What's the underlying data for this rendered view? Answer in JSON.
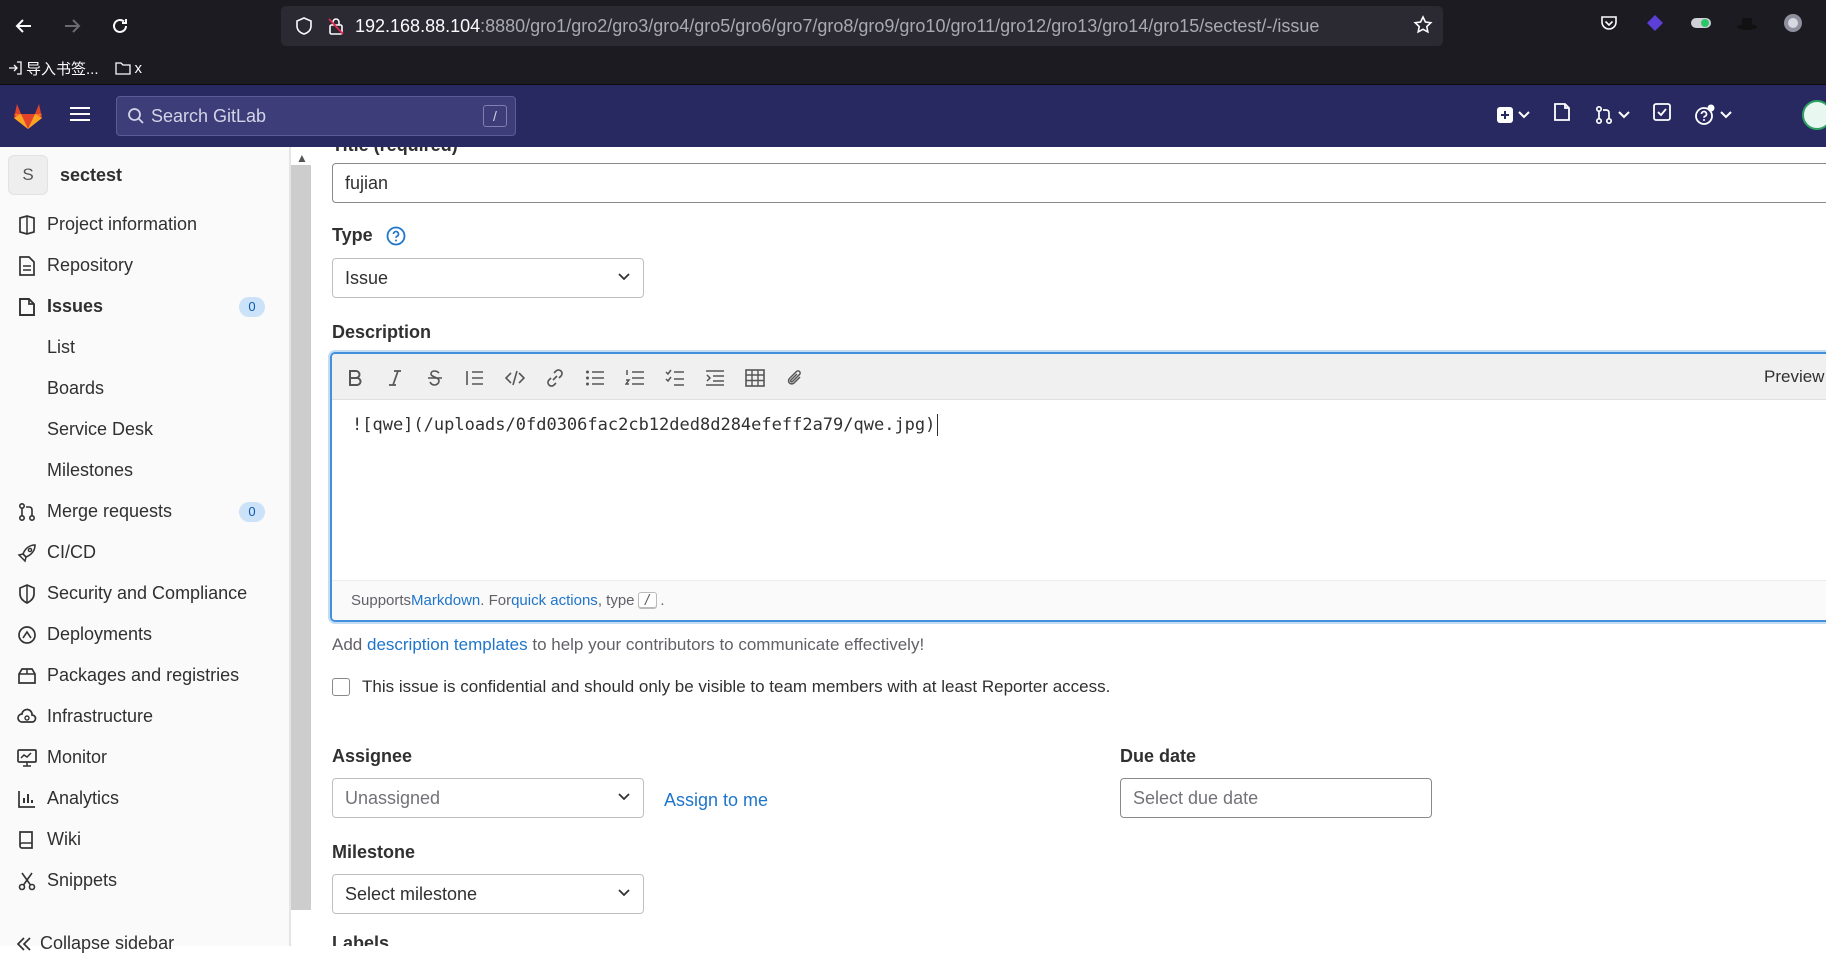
{
  "browser": {
    "url_host": "192.168.88.104",
    "url_path": ":8880/gro1/gro2/gro3/gro4/gro5/gro6/gro7/gro8/gro9/gro10/gro11/gro12/gro13/gro14/gro15/sectest/-/issue",
    "bookmarks": [
      {
        "label": "导入书签..."
      },
      {
        "label": "x"
      }
    ]
  },
  "header": {
    "search_placeholder": "Search GitLab",
    "search_shortcut": "/"
  },
  "sidebar": {
    "project_initial": "S",
    "project_name": "sectest",
    "items": [
      {
        "label": "Project information",
        "icon": "project-icon"
      },
      {
        "label": "Repository",
        "icon": "document-icon"
      },
      {
        "label": "Issues",
        "icon": "issues-icon",
        "badge": "0"
      },
      {
        "label": "List"
      },
      {
        "label": "Boards"
      },
      {
        "label": "Service Desk"
      },
      {
        "label": "Milestones"
      },
      {
        "label": "Merge requests",
        "icon": "merge-request-icon",
        "badge": "0"
      },
      {
        "label": "CI/CD",
        "icon": "rocket-icon"
      },
      {
        "label": "Security and Compliance",
        "icon": "shield-icon"
      },
      {
        "label": "Deployments",
        "icon": "deployments-icon"
      },
      {
        "label": "Packages and registries",
        "icon": "package-icon"
      },
      {
        "label": "Infrastructure",
        "icon": "cloud-gear-icon"
      },
      {
        "label": "Monitor",
        "icon": "monitor-icon"
      },
      {
        "label": "Analytics",
        "icon": "chart-icon"
      },
      {
        "label": "Wiki",
        "icon": "book-icon"
      },
      {
        "label": "Snippets",
        "icon": "scissors-icon"
      }
    ],
    "collapse_label": "Collapse sidebar"
  },
  "form": {
    "title_label_partial": "Title (required)",
    "title_value": "fujian",
    "type_label": "Type",
    "type_value": "Issue",
    "description_label": "Description",
    "preview_label": "Preview",
    "description_value": "![qwe](/uploads/0fd0306fac2cb12ded8d284efeff2a79/qwe.jpg)",
    "footer_supports": "Supports ",
    "footer_markdown": "Markdown",
    "footer_for": ". For ",
    "footer_quick_actions": "quick actions",
    "footer_type": ", type ",
    "footer_key": "/",
    "footer_end": ".",
    "templates_prefix": "Add ",
    "templates_link": "description templates",
    "templates_suffix": " to help your contributors to communicate effectively!",
    "confidential_text": "This issue is confidential and should only be visible to team members with at least Reporter access.",
    "assignee_label": "Assignee",
    "assignee_value": "Unassigned",
    "assign_to_me": "Assign to me",
    "due_date_label": "Due date",
    "due_date_placeholder": "Select due date",
    "milestone_label": "Milestone",
    "milestone_value": "Select milestone",
    "labels_label": "Labels"
  }
}
